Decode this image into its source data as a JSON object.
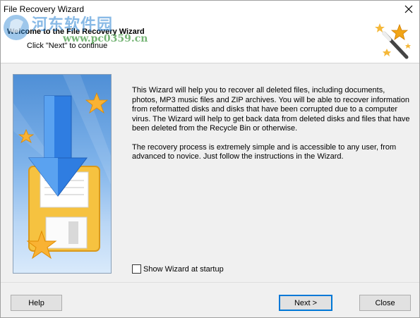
{
  "window": {
    "title": "File Recovery Wizard",
    "close_icon": "close-x-icon"
  },
  "header": {
    "title": "Welcome to the File Recovery Wizard",
    "subtitle": "Click \"Next\" to continue",
    "icon": "magic-wand-stars-icon"
  },
  "watermark": {
    "text_cn": "河东软件园",
    "url": "www.pc0359.cn"
  },
  "art": {
    "icon": "floppy-disk-download-arrow-stars-illustration"
  },
  "body": {
    "paragraph1": "This Wizard will help you to recover all deleted files, including documents, photos, MP3 music files and ZIP archives. You will be able to recover information from reformatted disks and disks that have been corrupted due to a computer virus. The Wizard will help to get back data from deleted disks and files that have been deleted from the Recycle Bin or otherwise.",
    "paragraph2": "The recovery process is extremely simple and is accessible to any user, from advanced to novice. Just follow the instructions in the Wizard."
  },
  "startup_checkbox": {
    "label": "Show Wizard at startup",
    "checked": false
  },
  "buttons": {
    "help": "Help",
    "next": "Next >",
    "close": "Close"
  },
  "colors": {
    "accent": "#0078d7",
    "art_top": "#4f8fd6",
    "art_bottom": "#d9eafb",
    "disk": "#f6c240",
    "arrow": "#2f7de1",
    "star": "#f9b233"
  }
}
